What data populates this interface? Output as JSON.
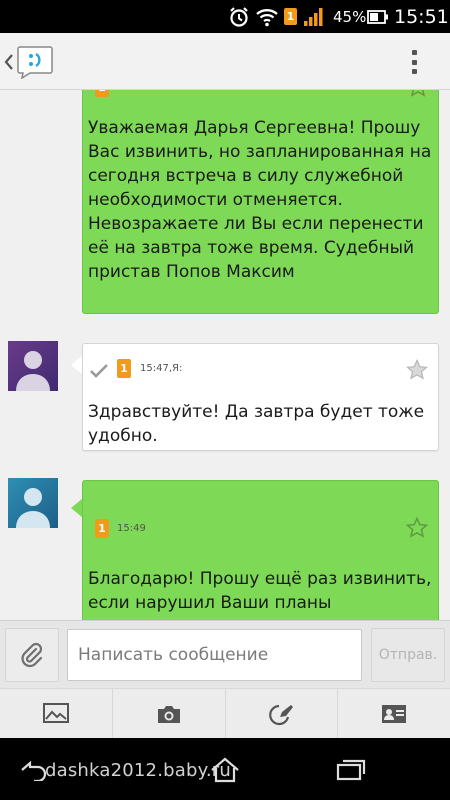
{
  "status_bar": {
    "battery_percent": "45%",
    "time": "15:51",
    "sim_label": "1",
    "icons": [
      "alarm-icon",
      "wifi-icon",
      "sim-icon",
      "signal-icon",
      "battery-icon"
    ]
  },
  "action_bar": {
    "icons": [
      "back-chevron-icon",
      "app-logo-icon",
      "overflow-menu-icon"
    ]
  },
  "messages": [
    {
      "direction": "incoming",
      "text": "Уважаемая Дарья Сергеевна! Прошу Вас извинить, но запланированная на сегодня встреча в силу служебной необходимости отменяется. Невозражаете ли Вы если перенести её на завтра тоже время. Судебный пристав Попов Максим",
      "sim": "1"
    },
    {
      "direction": "outgoing",
      "time": "15:47,Я:",
      "text": "Здравствуйте! Да завтра будет тоже удобно.",
      "sim": "1"
    },
    {
      "direction": "incoming",
      "time": "15:49",
      "text": "Благодарю! Прошу ещё раз извинить, если нарушил Ваши планы",
      "sim": "1"
    }
  ],
  "compose": {
    "placeholder": "Написать сообщение",
    "value": "",
    "send_label": "Отправ."
  },
  "attach_toolbar": {
    "items": [
      "picture-icon",
      "camera-icon",
      "sketch-icon",
      "contact-card-icon"
    ]
  },
  "nav_bar": {
    "watermark": "dashka2012.baby.ru"
  },
  "colors": {
    "incoming_bubble": "#7ed957",
    "outgoing_bubble": "#ffffff",
    "sim_badge": "#f29a1a",
    "accent": "#29a8e0"
  }
}
